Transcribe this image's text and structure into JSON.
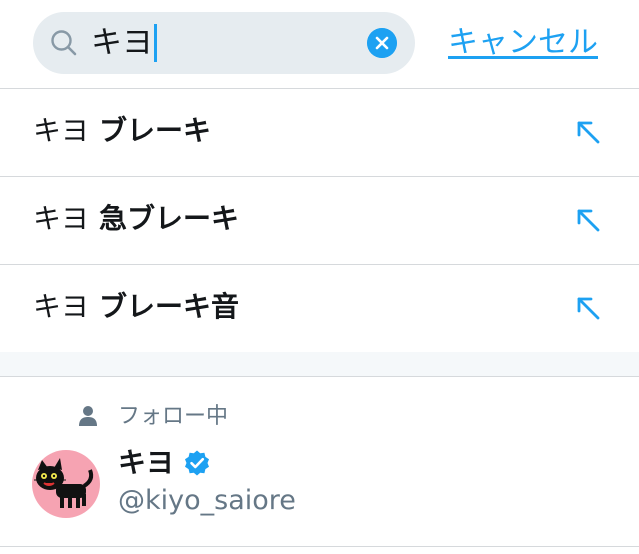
{
  "search": {
    "query": "キヨ",
    "cancel_label": "キャンセル"
  },
  "suggestions": [
    {
      "query_part": "キヨ",
      "completion": "ブレーキ"
    },
    {
      "query_part": "キヨ",
      "completion": "急ブレーキ"
    },
    {
      "query_part": "キヨ",
      "completion": "ブレーキ音"
    }
  ],
  "following": {
    "label": "フォロー中",
    "user": {
      "name": "キヨ",
      "handle": "@kiyo_saiore",
      "verified": true
    }
  },
  "colors": {
    "accent": "#1da1f2",
    "muted": "#657786",
    "divider": "#d6d9dc",
    "search_bg": "#e6ecf0",
    "avatar_bg": "#f6a3b2"
  },
  "icons": [
    "search-icon",
    "clear-icon",
    "fill-query-arrow-icon",
    "person-icon",
    "verified-badge-icon"
  ]
}
